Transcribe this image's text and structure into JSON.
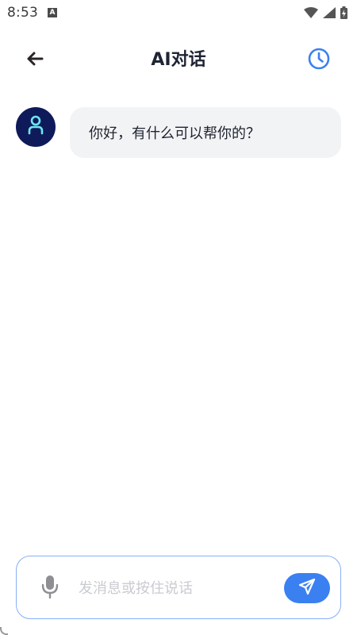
{
  "status_bar": {
    "time": "8:53",
    "notification_badge": "A",
    "icons": [
      "wifi-icon",
      "signal-icon",
      "battery-charging-icon"
    ]
  },
  "header": {
    "title": "AI对话",
    "back_icon": "arrow-left-icon",
    "history_icon": "clock-icon"
  },
  "messages": [
    {
      "role": "assistant",
      "text": "你好，有什么可以帮你的？",
      "avatar_icon": "assistant-avatar-icon"
    }
  ],
  "input_bar": {
    "placeholder": "发消息或按住说话",
    "value": "",
    "mic_icon": "microphone-icon",
    "send_icon": "send-icon"
  },
  "colors": {
    "accent": "#3a80f0",
    "avatar_bg": "#0f1a5a",
    "bubble_bg": "#f2f3f5",
    "input_border": "#88aef5"
  }
}
